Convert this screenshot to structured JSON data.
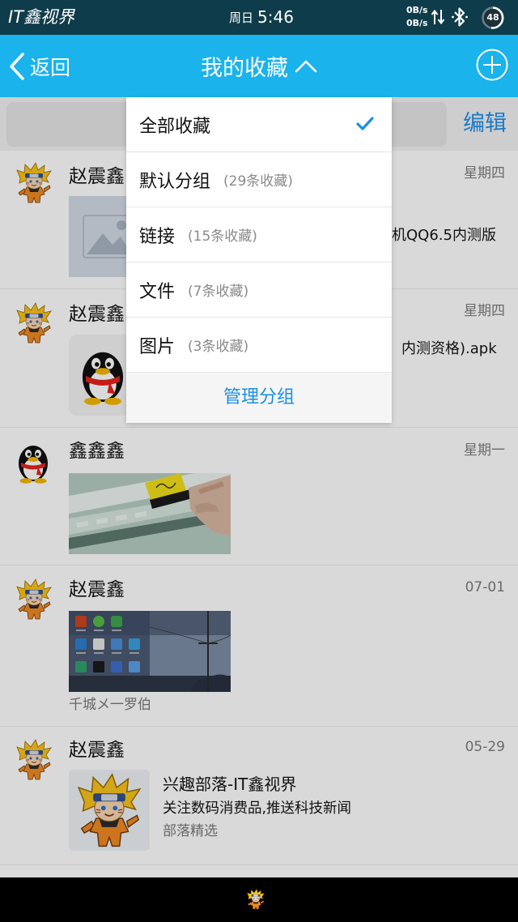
{
  "colors": {
    "status_bar": "#0f3c4a",
    "header": "#1ab3eb",
    "accent": "#1a8fe0",
    "edit_link": "#1e90ea"
  },
  "status_bar": {
    "app_label": "IT鑫视界",
    "day": "周日",
    "time": "5:46",
    "net_speed_up": "0B/s",
    "net_speed_down": "0B/s",
    "battery_level": "48",
    "icons": [
      "data-transfer-icon",
      "bluetooth-icon",
      "battery-icon"
    ]
  },
  "header": {
    "back_label": "返回",
    "title": "我的收藏",
    "icons": [
      "chevron-left-icon",
      "chevron-up-icon",
      "plus-circle-icon"
    ]
  },
  "toolbar": {
    "edit_label": "编辑"
  },
  "dropdown": {
    "items": [
      {
        "label": "全部收藏",
        "count": "",
        "selected": true
      },
      {
        "label": "默认分组",
        "count": "(29条收藏)",
        "selected": false
      },
      {
        "label": "链接",
        "count": "(15条收藏)",
        "selected": false
      },
      {
        "label": "文件",
        "count": "(7条收藏)",
        "selected": false
      },
      {
        "label": "图片",
        "count": "(3条收藏)",
        "selected": false
      }
    ],
    "manage_label": "管理分组"
  },
  "favorites": [
    {
      "author": "赵震鑫",
      "date": "星期四",
      "avatar": "naruto-avatar",
      "thumbnail": "image-placeholder-icon",
      "text": "机QQ6.5内测版"
    },
    {
      "author": "赵震鑫",
      "date": "星期四",
      "avatar": "naruto-avatar",
      "thumbnail": "qq-penguin-icon",
      "text": "内测资格).apk"
    },
    {
      "author": "鑫鑫鑫",
      "date": "星期一",
      "avatar": "qq-penguin-avatar",
      "thumbnail": "photo-hand-card"
    },
    {
      "author": "赵震鑫",
      "date": "07-01",
      "avatar": "naruto-avatar",
      "thumbnail": "photo-phone-screen",
      "caption": "千城メ一罗伯"
    },
    {
      "author": "赵震鑫",
      "date": "05-29",
      "avatar": "naruto-avatar",
      "thumbnail": "naruto-card",
      "card": {
        "title": "兴趣部落-IT鑫视界",
        "description": "关注数码消费品,推送科技新闻",
        "source": "部落精选"
      }
    }
  ]
}
